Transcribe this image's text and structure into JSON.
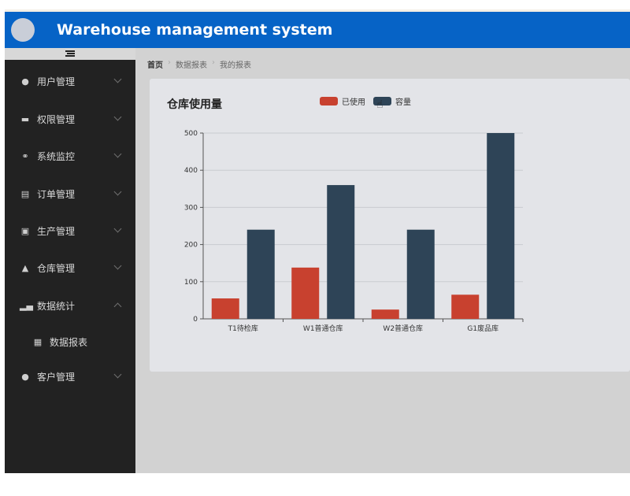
{
  "header": {
    "title": "Warehouse management system"
  },
  "sidebar": {
    "items": [
      {
        "label": "用户管理",
        "icon": "user-icon",
        "expanded": false
      },
      {
        "label": "权限管理",
        "icon": "monitor-icon",
        "expanded": false
      },
      {
        "label": "系统监控",
        "icon": "gauge-icon",
        "expanded": false
      },
      {
        "label": "订单管理",
        "icon": "document-icon",
        "expanded": false
      },
      {
        "label": "生产管理",
        "icon": "clipboard-icon",
        "expanded": false
      },
      {
        "label": "仓库管理",
        "icon": "home-icon",
        "expanded": false
      },
      {
        "label": "数据统计",
        "icon": "bar-chart-icon",
        "expanded": true
      },
      {
        "label": "数据报表",
        "icon": "grid-icon",
        "sub": true
      },
      {
        "label": "客户管理",
        "icon": "user-icon",
        "expanded": false
      }
    ]
  },
  "breadcrumb": [
    "首页",
    "数据报表",
    "我的报表"
  ],
  "colors": {
    "used": "#c8412f",
    "capacity": "#2e4457",
    "header": "#0663c6",
    "sidebar": "#222222"
  },
  "chart_data": {
    "type": "bar",
    "title": "仓库使用量",
    "categories": [
      "T1待检库",
      "W1普通仓库",
      "W2普通仓库",
      "G1废品库"
    ],
    "series": [
      {
        "name": "已使用",
        "values": [
          55,
          138,
          25,
          65
        ]
      },
      {
        "name": "容量",
        "values": [
          240,
          360,
          240,
          500
        ]
      }
    ],
    "ylim": [
      0,
      500
    ],
    "yticks": [
      0,
      100,
      200,
      300,
      400,
      500
    ],
    "legend": "top"
  }
}
